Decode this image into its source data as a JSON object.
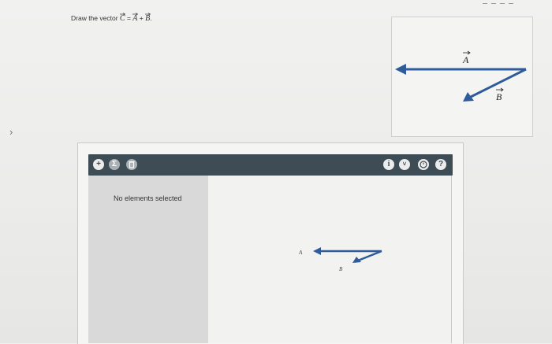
{
  "question": {
    "prefix": "Draw the vector",
    "c": "C",
    "equals": "=",
    "a": "A",
    "plus": "+",
    "b": "B",
    "period": "."
  },
  "reference_figure": {
    "label_a": "A",
    "label_b": "B",
    "arrow_color": "#2f5b9a"
  },
  "toolbar": {
    "add_icon": "plus-icon",
    "sum_icon": "sigma-icon",
    "delete_icon": "trash-icon",
    "info_icon": "info-icon",
    "dropdown_icon": "chevron-down-icon",
    "clock_icon": "clock-icon",
    "help_icon": "question-icon",
    "help_label": "?",
    "info_label": "i"
  },
  "left_pane": {
    "status": "No elements selected"
  },
  "canvas": {
    "label_a": "A",
    "label_b": "B"
  },
  "colors": {
    "toolbar_bg": "#3e4d55",
    "vector_blue": "#2f5b9a",
    "pane_gray": "#d9d9d9"
  }
}
